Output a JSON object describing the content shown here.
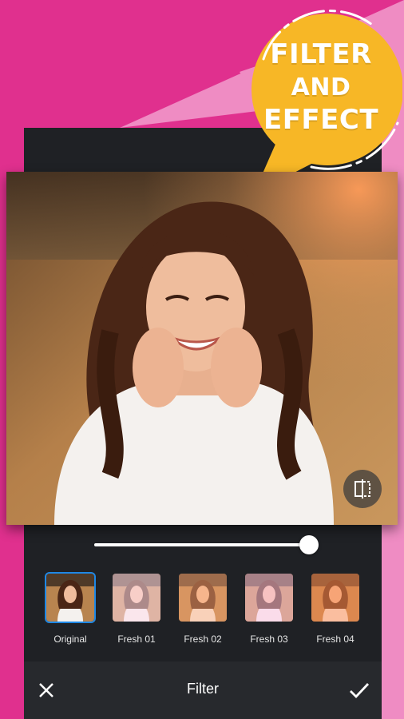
{
  "colors": {
    "background_pink": "#e0308e",
    "light_pink": "#ef8cc3",
    "badge_yellow": "#f7b726",
    "editor_dark": "#1f2125",
    "toolbar_dark": "#27292d",
    "selected_blue": "#1e88e5"
  },
  "badge": {
    "line1": "FILTER",
    "line2": "AND",
    "line3": "EFFECT"
  },
  "photo": {
    "description_icon": "portrait-photo"
  },
  "compare_button": {
    "icon": "compare-split-icon"
  },
  "intensity": {
    "value_fraction": 0.96
  },
  "filters": [
    {
      "label": "Original",
      "selected": true
    },
    {
      "label": "Fresh 01",
      "selected": false
    },
    {
      "label": "Fresh 02",
      "selected": false
    },
    {
      "label": "Fresh 03",
      "selected": false
    },
    {
      "label": "Fresh 04",
      "selected": false
    }
  ],
  "toolbar": {
    "title": "Filter",
    "cancel_icon": "close-icon",
    "confirm_icon": "check-icon"
  }
}
